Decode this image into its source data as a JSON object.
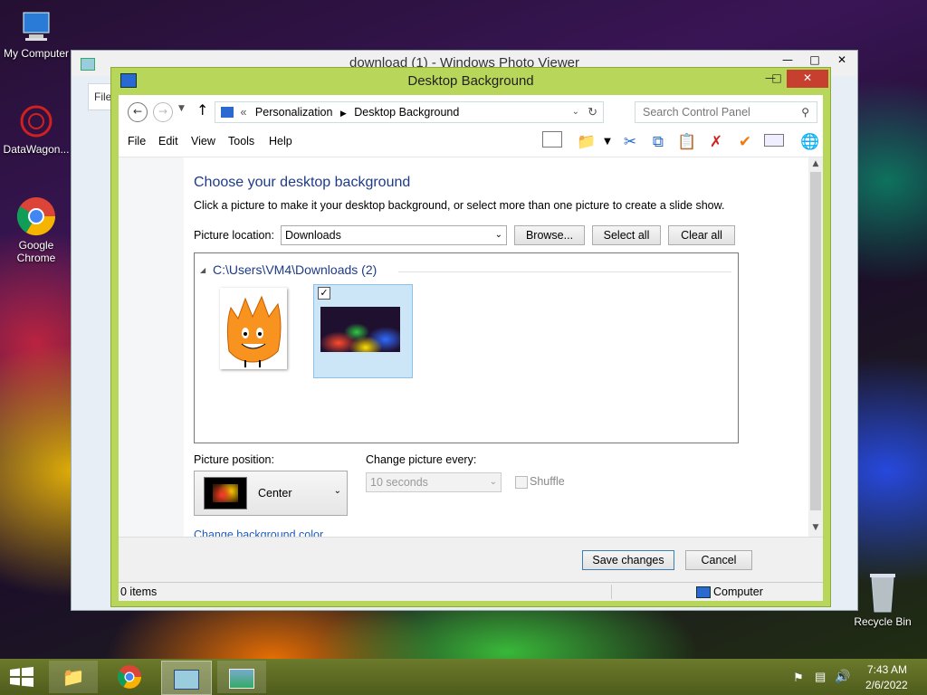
{
  "desktop": {
    "icons": [
      {
        "label": "My Computer"
      },
      {
        "label": "DataWagon..."
      },
      {
        "label": "Google Chrome"
      },
      {
        "label": "Recycle Bin"
      }
    ]
  },
  "photo_viewer": {
    "title": "download (1) - Windows Photo Viewer",
    "menu_label": "File"
  },
  "dialog": {
    "title": "Desktop Background",
    "breadcrumb": {
      "sep": "«",
      "items": [
        "Personalization",
        "Desktop Background"
      ]
    },
    "search_placeholder": "Search Control Panel",
    "menu": [
      "File",
      "Edit",
      "View",
      "Tools",
      "Help"
    ],
    "heading": "Choose your desktop background",
    "subtext": "Click a picture to make it your desktop background, or select more than one picture to create a slide show.",
    "picture_location_label": "Picture location:",
    "picture_location_value": "Downloads",
    "browse_label": "Browse...",
    "select_all_label": "Select all",
    "clear_all_label": "Clear all",
    "folder_label": "C:\\Users\\VM4\\Downloads (2)",
    "second_thumb_checked": true,
    "picture_position_label": "Picture position:",
    "picture_position_value": "Center",
    "change_every_label": "Change picture every:",
    "change_every_value": "10 seconds",
    "shuffle_label": "Shuffle",
    "link_label": "Change background color",
    "save_label": "Save changes",
    "cancel_label": "Cancel",
    "status_items": "0 items",
    "status_computer": "Computer"
  },
  "taskbar": {
    "time": "7:43 AM",
    "date": "2/6/2022"
  }
}
